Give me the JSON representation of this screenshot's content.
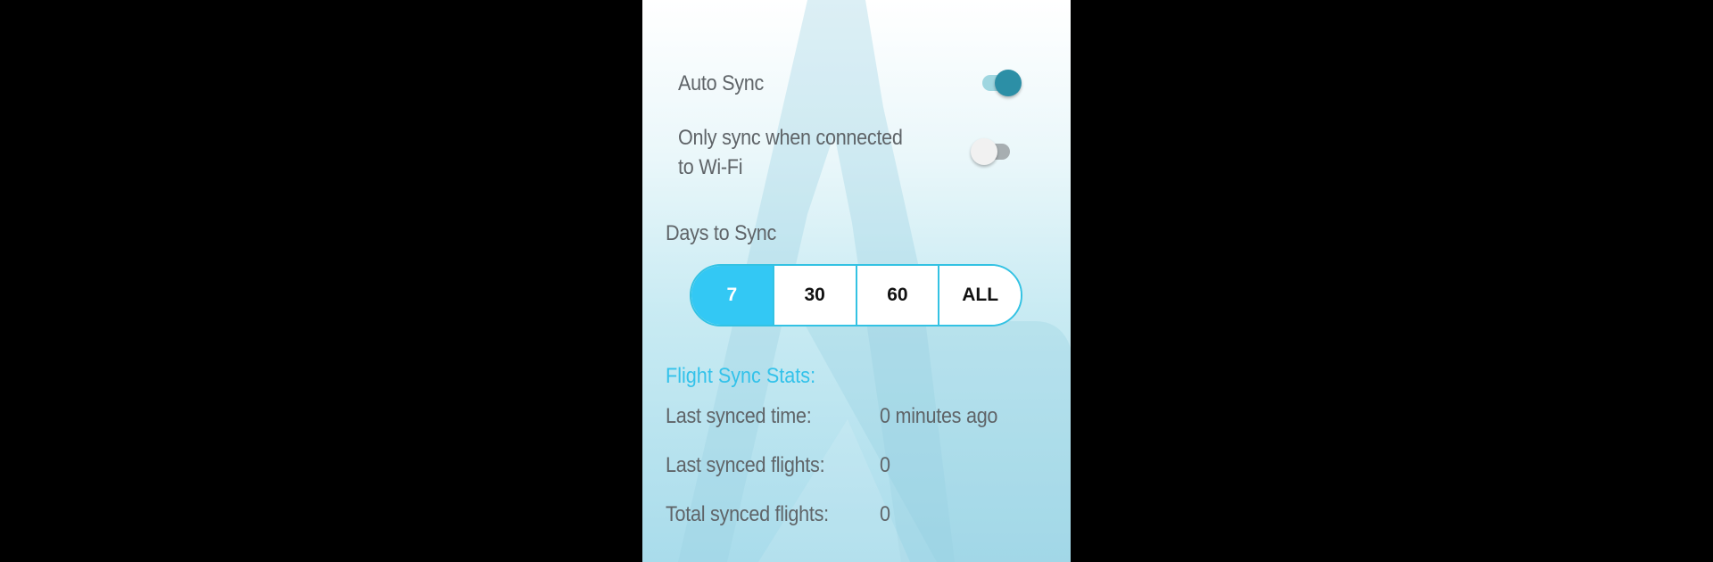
{
  "settings": {
    "auto_sync": {
      "label": "Auto Sync",
      "enabled": true
    },
    "wifi_only": {
      "label_line1": "Only sync when connected",
      "label_line2": "to Wi-Fi",
      "enabled": false
    }
  },
  "days_to_sync": {
    "label": "Days to Sync",
    "options": [
      "7",
      "30",
      "60",
      "ALL"
    ],
    "selected": "7"
  },
  "stats": {
    "heading": "Flight Sync Stats:",
    "rows": [
      {
        "label": "Last synced time:",
        "value": "0 minutes ago"
      },
      {
        "label": "Last synced flights:",
        "value": "0"
      },
      {
        "label": "Total synced flights:",
        "value": "0"
      }
    ]
  },
  "colors": {
    "accent": "#33C8F4",
    "toggle_on": "#2C8FA6",
    "text": "#5F6468"
  },
  "icons": {
    "background": "app-logo-watermark"
  }
}
